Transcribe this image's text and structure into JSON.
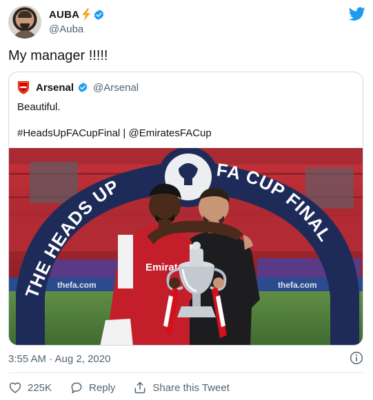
{
  "author": {
    "display_name": "AUBA",
    "handle": "@Auba"
  },
  "tweet_text": "My manager !!!!!",
  "quoted": {
    "display_name": "Arsenal",
    "handle": "@Arsenal",
    "line1": "Beautiful.",
    "line2": "#HeadsUpFACupFinal | @EmiratesFACup",
    "photo": {
      "arch_left": "THE HEADS UP",
      "arch_right": "FA CUP FINAL",
      "shirt_text": "Emirates",
      "board_text": "thefa.com"
    }
  },
  "meta": {
    "timestamp": "3:55 AM · Aug 2, 2020"
  },
  "actions": {
    "likes": "225K",
    "reply": "Reply",
    "share": "Share this Tweet"
  },
  "colors": {
    "brand_blue": "#1d9bf0",
    "text_secondary": "#536471",
    "border": "#cfd9de",
    "arsenal_red": "#db0007",
    "arch_navy": "#1e2b58"
  },
  "icons": [
    "lightning-bolt-icon",
    "verified-badge-icon",
    "twitter-bird-icon",
    "arsenal-crest-icon",
    "info-icon",
    "heart-icon",
    "reply-icon",
    "share-icon"
  ]
}
